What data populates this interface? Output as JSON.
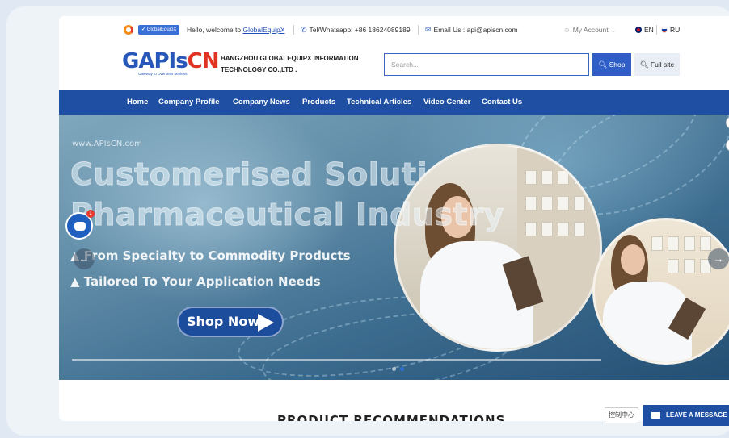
{
  "topbar": {
    "badge": "GlobalEquipX",
    "hello_prefix": "Hello, welcome to ",
    "hello_link": "GlobalEquipX",
    "tel": "Tel/Whatsapp: +86 18624089189",
    "email": "Email Us : api@apiscn.com",
    "account": "My Account",
    "lang_en": "EN",
    "lang_ru": "RU"
  },
  "header": {
    "logo_a": "GAPIs",
    "logo_b": "CN",
    "logo_sub": "Gateway to Overseas Markets",
    "company": "HANGZHOU GLOBALEQUIPX INFORMATION TECHNOLOGY CO.,LTD .",
    "search_placeholder": "Search...",
    "shop_button": "Shop",
    "full_site_button": "Full site"
  },
  "nav": {
    "items": [
      "Home",
      "Company Profile",
      "Company News",
      "Products",
      "Technical Articles",
      "Video Center",
      "Contact Us"
    ]
  },
  "hero": {
    "watermark": "www.APIsCN.com",
    "headline_1": "Customerised Solutions For",
    "headline_2": "Pharmaceutical Industry",
    "bullet_1": "▲ From Specialty to Commodity Products",
    "bullet_2": "▲ Tailored To Your Application Needs",
    "cta": "Shop Now",
    "prev_arrow": "←",
    "next_arrow": "→",
    "active_slide": 2,
    "slide_count": 2
  },
  "section": {
    "heading": "PRODUCT RECOMMENDATIONS"
  },
  "widgets": {
    "chat_badge": "1",
    "control_center": "控制中心",
    "leave_message": "LEAVE A MESSAGE"
  },
  "colors": {
    "brand_blue": "#1f4fa3",
    "accent_red": "#e03324"
  }
}
